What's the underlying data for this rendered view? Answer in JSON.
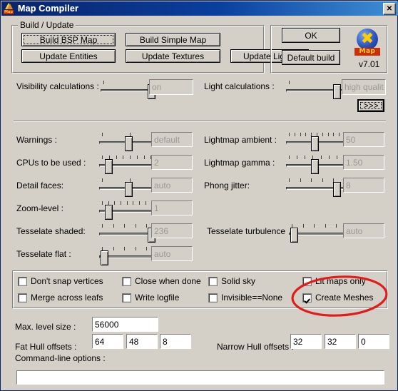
{
  "window": {
    "title": "Map Compiler",
    "icon": "map-compiler-icon",
    "close_label": "✕"
  },
  "build_group": {
    "title": "Build / Update",
    "buttons": [
      {
        "id": "build-bsp-map",
        "label": "Build BSP Map",
        "focused": true
      },
      {
        "id": "build-simple-map",
        "label": "Build Simple Map",
        "focused": false
      },
      {
        "id": "update-entities",
        "label": "Update Entities",
        "focused": false
      },
      {
        "id": "update-textures",
        "label": "Update Textures",
        "focused": false
      },
      {
        "id": "update-lights",
        "label": "Update Lights",
        "focused": false
      }
    ]
  },
  "action_group": {
    "ok_label": "OK",
    "default_build_label": "Default build",
    "version": "v7.01",
    "logo_text": "Map"
  },
  "sliders_top": [
    {
      "id": "visibility-calculations",
      "label": "Visibility calculations :",
      "value": "on",
      "ticks": 2,
      "thumb_pct": 88
    },
    {
      "id": "light-calculations",
      "label": "Light calculations :",
      "value": "high qualit",
      "ticks": 2,
      "thumb_pct": 88
    }
  ],
  "more_button_label": ">>>",
  "sliders_left": [
    {
      "id": "warnings",
      "label": "Warnings :",
      "value": "default",
      "ticks": 3,
      "thumb_pct": 48
    },
    {
      "id": "cpus-to-be-used",
      "label": "CPUs to be used :",
      "value": "2",
      "ticks": 9,
      "thumb_pct": 10
    },
    {
      "id": "detail-faces",
      "label": "Detail faces:",
      "value": "auto",
      "ticks": 3,
      "thumb_pct": 48
    },
    {
      "id": "zoom-level",
      "label": "Zoom-level :",
      "value": "1",
      "ticks": 10,
      "thumb_pct": 10
    },
    {
      "id": "tesselate-shaded",
      "label": "Tesselate shaded:",
      "value": "236",
      "ticks": 6,
      "thumb_pct": 90
    },
    {
      "id": "tesselate-flat",
      "label": "Tesselate flat :",
      "value": "auto",
      "ticks": 6,
      "thumb_pct": 2
    }
  ],
  "sliders_right": [
    {
      "id": "lightmap-ambient",
      "label": "Lightmap ambient :",
      "value": "50",
      "ticks": 11,
      "thumb_pct": 46
    },
    {
      "id": "lightmap-gamma",
      "label": "Lightmap gamma :",
      "value": "1.50",
      "ticks": 8,
      "thumb_pct": 46
    },
    {
      "id": "phong-jitter",
      "label": "Phong jitter:",
      "value": "8",
      "ticks": 6,
      "thumb_pct": 88
    },
    {
      "id": "tesselate-turbulence",
      "label": "Tesselate turbulence",
      "value": "auto",
      "ticks": 6,
      "thumb_pct": 2
    }
  ],
  "checkboxes": [
    {
      "id": "dont-snap-vertices",
      "label": "Don't snap vertices",
      "checked": false
    },
    {
      "id": "close-when-done",
      "label": "Close when done",
      "checked": false
    },
    {
      "id": "solid-sky",
      "label": "Solid sky",
      "checked": false
    },
    {
      "id": "lit-maps-only",
      "label": "Lit maps only",
      "checked": false
    },
    {
      "id": "merge-across-leafs",
      "label": "Merge across leafs",
      "checked": false
    },
    {
      "id": "write-logfile",
      "label": "Write logfile",
      "checked": false
    },
    {
      "id": "invisible-equals-none",
      "label": "Invisible==None",
      "checked": false
    },
    {
      "id": "create-meshes",
      "label": "Create Meshes",
      "checked": true
    }
  ],
  "bottom": {
    "max_level_size_label": "Max. level size :",
    "max_level_size_value": "56000",
    "fat_hull_label": "Fat Hull offsets :",
    "fat_hull_values": [
      "64",
      "48",
      "8"
    ],
    "narrow_hull_label": "Narrow Hull offsets :",
    "narrow_hull_values": [
      "32",
      "32",
      "0"
    ],
    "command_line_label": "Command-line options :",
    "command_line_value": ""
  },
  "annotation": {
    "shape": "red-ellipse",
    "color": "#e21b1b",
    "target": "create-meshes"
  }
}
